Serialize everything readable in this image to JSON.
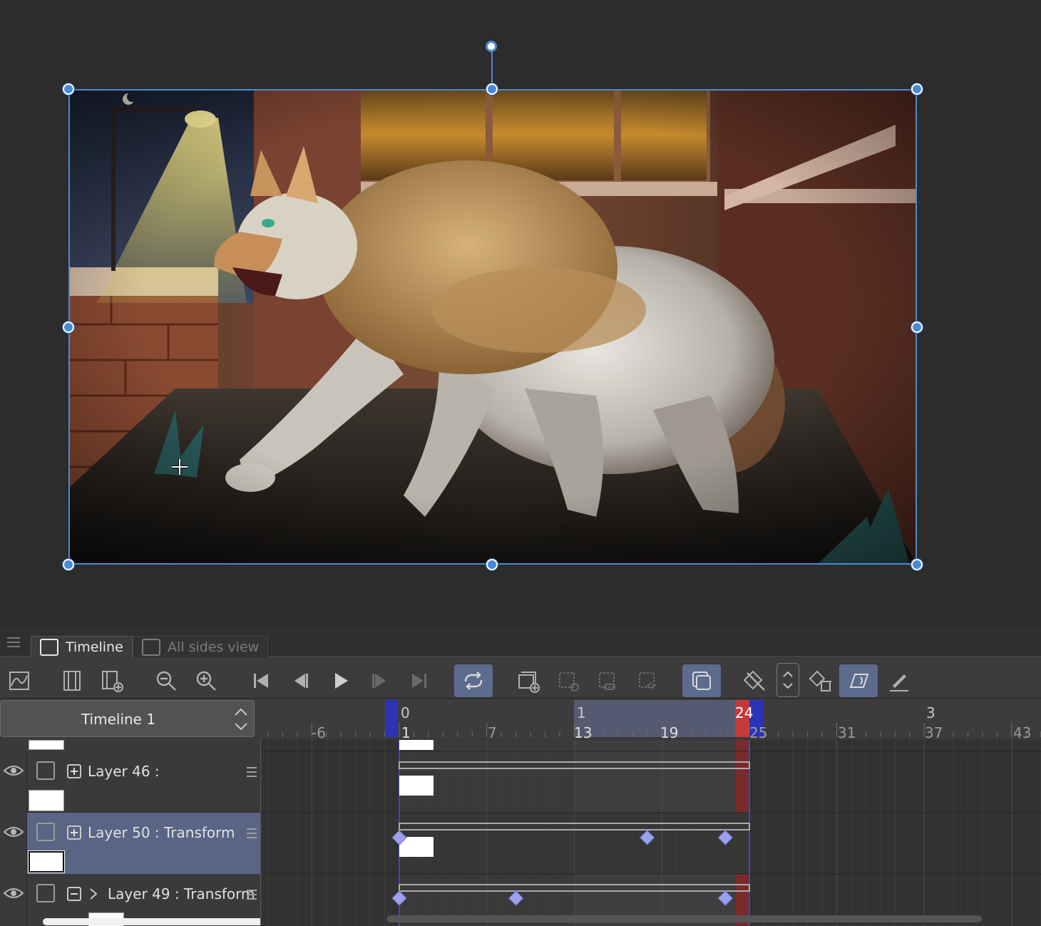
{
  "panel": {
    "tabs": [
      {
        "label": "Timeline",
        "icon": "timeline-icon",
        "active": true
      },
      {
        "label": "All sides view",
        "icon": "camera-icon",
        "active": false
      }
    ]
  },
  "timeline": {
    "name": "Timeline 1",
    "ruler": {
      "seconds": [
        {
          "label": "0",
          "frame": 1
        },
        {
          "label": "1",
          "frame": 13
        },
        {
          "label": "24",
          "frame": 24
        },
        {
          "label": "3",
          "frame": 37
        }
      ],
      "frames": [
        "-6",
        "1",
        "7",
        "13",
        "19",
        "25",
        "31",
        "37",
        "43"
      ]
    },
    "playback_start": 1,
    "playback_end": 24
  },
  "layers": [
    {
      "name": "Layer 46 :",
      "expand": "plus",
      "selected": false,
      "keyframes": []
    },
    {
      "name": "Layer 50 : Transform",
      "expand": "plus",
      "selected": true,
      "keyframes": [
        1,
        18,
        24
      ]
    },
    {
      "name": "Layer 49 : Transform",
      "expand": "minus",
      "chevron": true,
      "selected": false,
      "keyframes": [
        1,
        9,
        24
      ]
    }
  ],
  "colors": {
    "selection": "#4a8ad4",
    "keyframe": "#9aa2ee",
    "end_marker": "#c43a3a",
    "start_marker": "#2b33b8",
    "toggled": "#5c6b8e"
  }
}
